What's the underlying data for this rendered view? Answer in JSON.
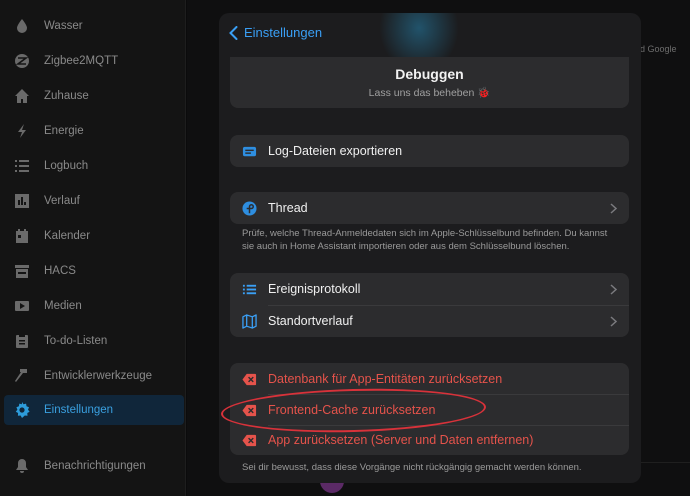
{
  "sidebar": {
    "items": [
      {
        "label": "Wasser",
        "icon": "water-drop-icon",
        "active": false
      },
      {
        "label": "Zigbee2MQTT",
        "icon": "zigbee-icon",
        "active": false
      },
      {
        "label": "Zuhause",
        "icon": "home-icon",
        "active": false
      },
      {
        "label": "Energie",
        "icon": "lightning-icon",
        "active": false
      },
      {
        "label": "Logbuch",
        "icon": "list-icon",
        "active": false
      },
      {
        "label": "Verlauf",
        "icon": "chart-icon",
        "active": false
      },
      {
        "label": "Kalender",
        "icon": "calendar-icon",
        "active": false
      },
      {
        "label": "HACS",
        "icon": "hacs-icon",
        "active": false
      },
      {
        "label": "Medien",
        "icon": "media-icon",
        "active": false
      },
      {
        "label": "To-do-Listen",
        "icon": "clipboard-icon",
        "active": false
      },
      {
        "label": "Entwicklerwerkzeuge",
        "icon": "hammer-icon",
        "active": false
      },
      {
        "label": "Einstellungen",
        "icon": "gear-icon",
        "active": true
      },
      {
        "label": "Benachrichtigungen",
        "icon": "bell-icon",
        "active": false
      }
    ]
  },
  "background": {
    "right_text": "d Google"
  },
  "sheet": {
    "back_label": "Einstellungen",
    "title": "Debuggen",
    "subtitle": "Lass uns das beheben 🐞",
    "export_logs": "Log-Dateien exportieren",
    "thread_label": "Thread",
    "thread_note": "Prüfe, welche Thread-Anmeldedaten sich im Apple-Schlüsselbund befinden. Du kannst sie auch in Home Assistant importieren oder aus dem Schlüsselbund löschen.",
    "event_log": "Ereignisprotokoll",
    "location_history": "Standortverlauf",
    "reset_db": "Datenbank für App-Entitäten zurücksetzen",
    "reset_frontend_cache": "Frontend-Cache zurücksetzen",
    "reset_app": "App zurücksetzen (Server und Daten entfernen)",
    "danger_note": "Sei dir bewusst, dass diese Vorgänge nicht rückgängig gemacht werden können."
  },
  "colors": {
    "accent": "#3a9ff5",
    "danger": "#e5534b",
    "annotation": "#d8323a",
    "sheet_bg": "#1c1c1e",
    "card_bg": "#2c2c2e"
  }
}
